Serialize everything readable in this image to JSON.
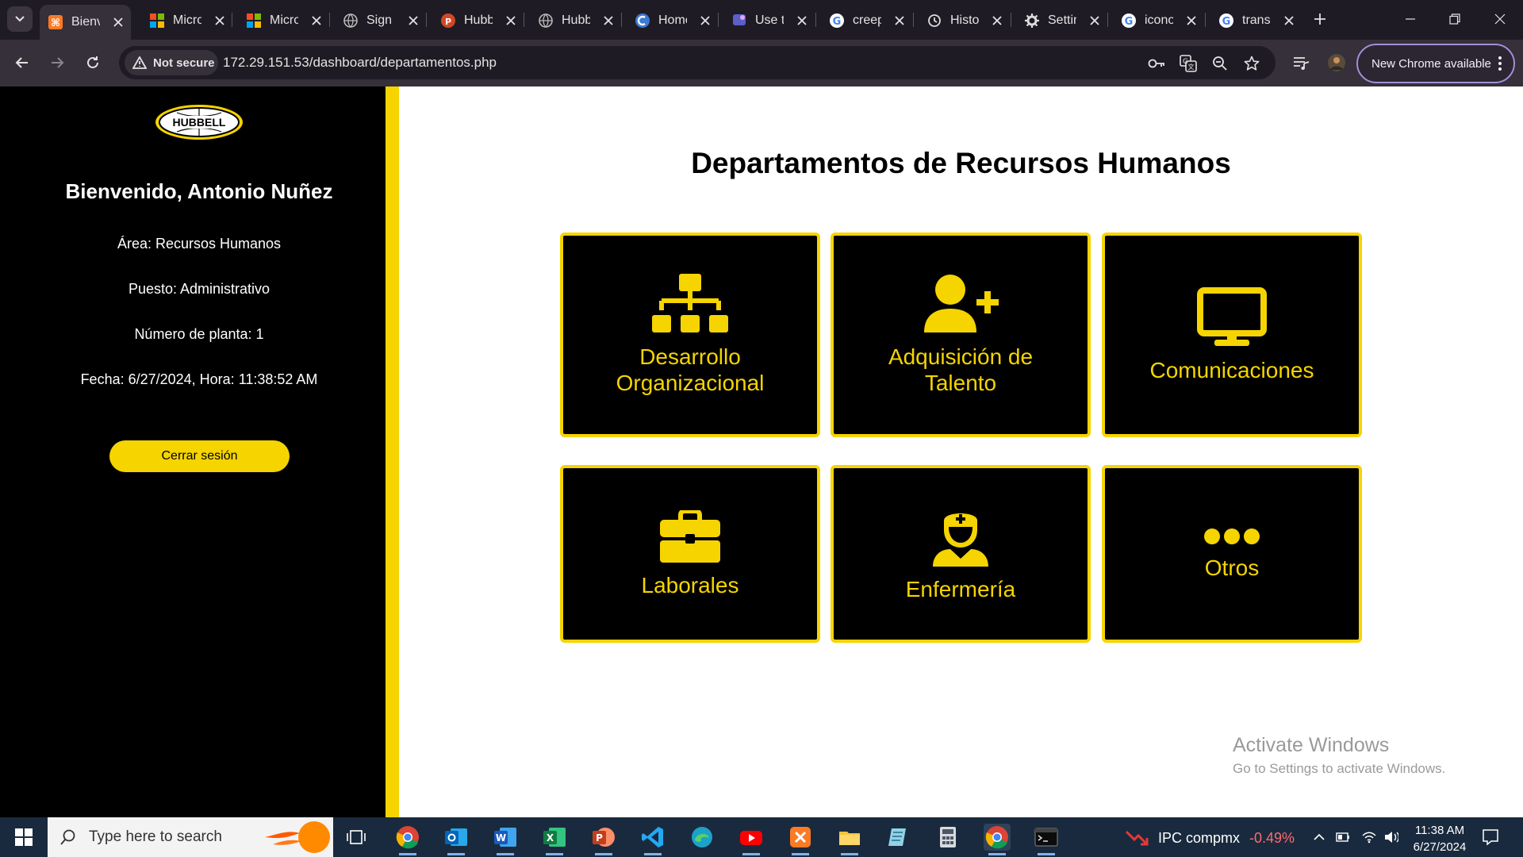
{
  "browser": {
    "tabs": [
      {
        "label": "Bienvenido",
        "icon": "xampp-icon",
        "active": true
      },
      {
        "label": "Microsoft",
        "icon": "microsoft-icon"
      },
      {
        "label": "Microsoft",
        "icon": "microsoft-icon"
      },
      {
        "label": "Sign in",
        "icon": "globe-icon"
      },
      {
        "label": "Hubbell",
        "icon": "powerpoint-icon"
      },
      {
        "label": "Hubbell",
        "icon": "globe-icon"
      },
      {
        "label": "Home",
        "icon": "copilot-icon"
      },
      {
        "label": "Use t",
        "icon": "teams-icon"
      },
      {
        "label": "creep",
        "icon": "google-icon"
      },
      {
        "label": "History",
        "icon": "history-icon"
      },
      {
        "label": "Settings",
        "icon": "gear-icon"
      },
      {
        "label": "iconos",
        "icon": "google-icon"
      },
      {
        "label": "trans",
        "icon": "google-icon"
      }
    ],
    "security_label": "Not secure",
    "url": "172.29.151.53/dashboard/departamentos.php",
    "update_label": "New Chrome available"
  },
  "sidebar": {
    "welcome": "Bienvenido, Antonio Nuñez",
    "area": "Área: Recursos Humanos",
    "puesto": "Puesto: Administrativo",
    "planta": "Número de planta: 1",
    "fecha": "Fecha: 6/27/2024, Hora: 11:38:52 AM",
    "logout_label": "Cerrar sesión",
    "logo_text": "HUBBELL"
  },
  "main": {
    "title": "Departamentos de Recursos Humanos",
    "cards": [
      {
        "label_line1": "Desarrollo",
        "label_line2": "Organizacional",
        "icon": "org-chart-icon"
      },
      {
        "label_line1": "Adquisición de",
        "label_line2": "Talento",
        "icon": "user-plus-icon"
      },
      {
        "label_line1": "Comunicaciones",
        "label_line2": "",
        "icon": "monitor-icon"
      },
      {
        "label_line1": "Laborales",
        "label_line2": "",
        "icon": "briefcase-icon"
      },
      {
        "label_line1": "Enfermería",
        "label_line2": "",
        "icon": "nurse-icon"
      },
      {
        "label_line1": "Otros",
        "label_line2": "",
        "icon": "ellipsis-icon"
      }
    ],
    "accent_color": "#f5d400"
  },
  "windows_watermark": {
    "line1": "Activate Windows",
    "line2": "Go to Settings to activate Windows."
  },
  "taskbar": {
    "search_placeholder": "Type here to search",
    "apps": [
      "chrome-icon",
      "outlook-icon",
      "word-icon",
      "excel-icon",
      "powerpoint-icon",
      "vscode-icon",
      "edge-icon",
      "youtube-icon",
      "xampp-icon",
      "file-explorer-icon",
      "notepad-icon",
      "calculator-icon",
      "chrome-icon",
      "terminal-icon"
    ],
    "stock_name": "IPC compmx",
    "stock_change": "-0.49%",
    "time": "11:38 AM",
    "date": "6/27/2024"
  }
}
